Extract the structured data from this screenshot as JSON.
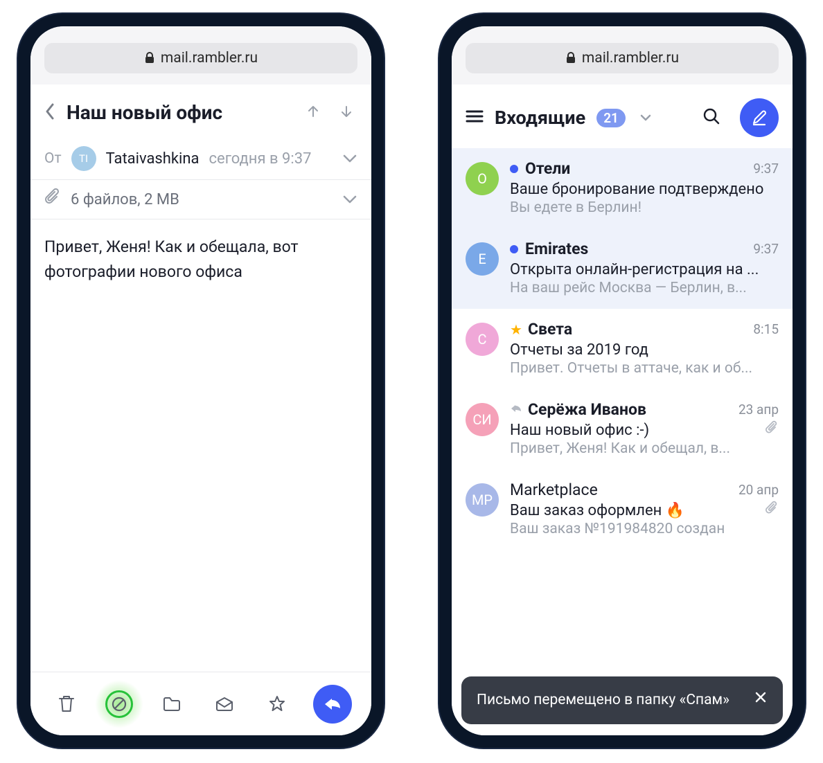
{
  "address_bar": {
    "url": "mail.rambler.ru"
  },
  "left": {
    "title": "Наш новый офис",
    "from_label": "От",
    "sender_initials": "TI",
    "sender_name": "Tataivashkina",
    "time": "сегодня в 9:37",
    "attachments": "6 файлов, 2 MB",
    "body": "Привет, Женя! Как и обещала, вот фотографии нового офиса"
  },
  "right": {
    "folder": "Входящие",
    "badge": "21",
    "messages": [
      {
        "avatar": "O",
        "color": "#8fd14f",
        "unread": true,
        "sender": "Отели",
        "time": "9:37",
        "subject": "Ваше бронирование подтверждено",
        "preview": "Вы едете в Берлин!"
      },
      {
        "avatar": "E",
        "color": "#7aa8e8",
        "unread": true,
        "sender": "Emirates",
        "time": "9:37",
        "subject": "Открыта онлайн-регистрация на ...",
        "preview": "На ваш рейс Москва — Берлин, в..."
      },
      {
        "avatar": "C",
        "color": "#f0a8d8",
        "starred": true,
        "sender": "Света",
        "time": "8:15",
        "subject": "Отчеты за 2019 год",
        "preview": "Привет. Отчеты в аттаче, как и об..."
      },
      {
        "avatar": "СИ",
        "color": "#f5a1b8",
        "replied": true,
        "sender": "Серёжа Иванов",
        "time": "23 апр",
        "subject": "Наш новый офис :-)",
        "preview": "Привет, Женя! Как и обещал, в...",
        "attachment": true
      },
      {
        "avatar": "MP",
        "color": "#a8b8e8",
        "sender": "Marketplace",
        "time": "20 апр",
        "subject": "Ваш заказ оформлен 🔥",
        "preview": "Ваш заказ №191984820 создан",
        "attachment": true
      }
    ],
    "toast": "Письмо перемещено в папку «Спам»"
  }
}
